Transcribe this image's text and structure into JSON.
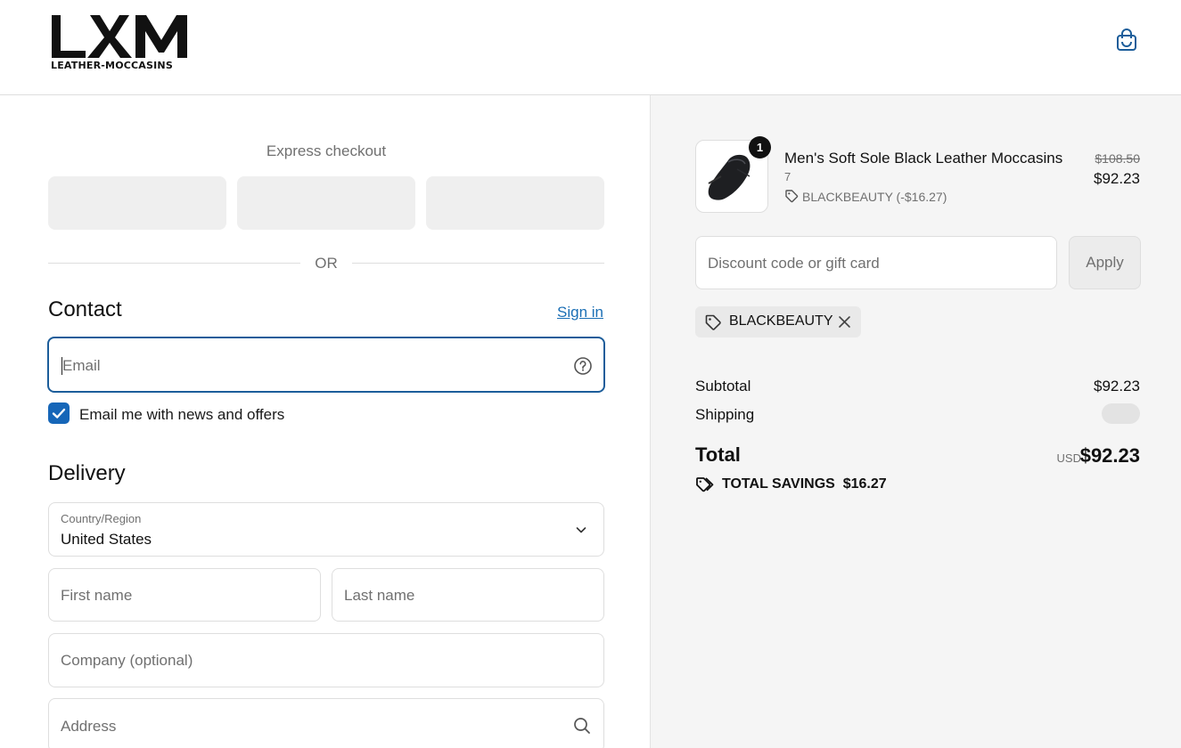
{
  "header": {
    "logo_mark": "LΛM",
    "logo_subtext": "LEATHER-MOCCASINS",
    "cart_icon": "shopping-bag-icon",
    "accent_color": "#1c5d9a"
  },
  "express_checkout": {
    "title": "Express checkout",
    "divider_text": "OR"
  },
  "contact": {
    "title": "Contact",
    "sign_in_link": "Sign in",
    "email_placeholder": "Email",
    "help_icon": "question-circle-icon",
    "newsletter_label": "Email me with news and offers",
    "newsletter_checked": true
  },
  "delivery": {
    "title": "Delivery",
    "country_label": "Country/Region",
    "country_value": "United States",
    "first_name_placeholder": "First name",
    "last_name_placeholder": "Last name",
    "company_placeholder": "Company (optional)",
    "address_placeholder": "Address",
    "address_icon": "search-icon"
  },
  "order_summary": {
    "item": {
      "quantity": "1",
      "name": "Men's Soft Sole Black Leather Moccasins",
      "variant": "7",
      "discount_line": "BLACKBEAUTY (-$16.27)",
      "original_price": "$108.50",
      "price": "$92.23"
    },
    "discount_placeholder": "Discount code or gift card",
    "apply_label": "Apply",
    "applied_code": "BLACKBEAUTY",
    "subtotal_label": "Subtotal",
    "subtotal_value": "$92.23",
    "shipping_label": "Shipping",
    "total_label": "Total",
    "currency": "USD",
    "total_value": "$92.23",
    "savings_label": "TOTAL SAVINGS",
    "savings_value": "$16.27"
  }
}
